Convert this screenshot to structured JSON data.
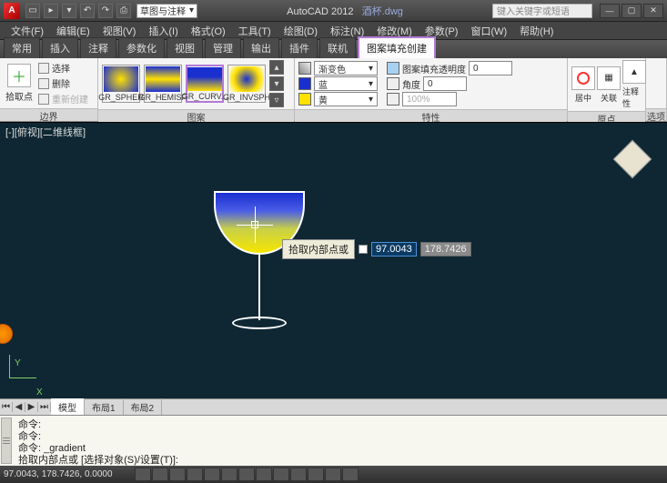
{
  "titlebar": {
    "app_letter": "A",
    "workspace_selector": "草图与注释",
    "app_name": "AutoCAD 2012",
    "doc_name": "酒杯.dwg",
    "search_placeholder": "键入关键字或短语"
  },
  "menubar": [
    "文件(F)",
    "编辑(E)",
    "视图(V)",
    "插入(I)",
    "格式(O)",
    "工具(T)",
    "绘图(D)",
    "标注(N)",
    "修改(M)",
    "参数(P)",
    "窗口(W)",
    "帮助(H)"
  ],
  "tabs": {
    "items": [
      "常用",
      "插入",
      "注释",
      "参数化",
      "视图",
      "管理",
      "输出",
      "插件",
      "联机",
      "图案填充创建"
    ],
    "active_index": 9
  },
  "ribbon": {
    "panel1": {
      "title": "边界",
      "big_label": "拾取点",
      "opt1": "选择",
      "opt2": "删除",
      "opt3": "重新创建"
    },
    "panel2": {
      "title": "图案",
      "items": [
        "GR_SPHER",
        "GR_HEMISP",
        "GR_CURV...",
        "GR_INVSPH"
      ],
      "selected_index": 2
    },
    "panel3": {
      "title": "特性",
      "pattern_label": "渐变色",
      "color1_label": "蓝",
      "color2_label": "黄",
      "transparency_label": "图案填充透明度",
      "transparency_value": "0",
      "angle_label": "角度",
      "angle_value": "0",
      "scale_value": "100%"
    },
    "panel4": {
      "title": "原点",
      "btn1": "居中",
      "btn2": "关联",
      "btn3": "注释性"
    },
    "panel5": {
      "title": "选项"
    }
  },
  "canvas": {
    "view_label": "[-][俯视][二维线框]",
    "tooltip": "拾取内部点或",
    "coord_x": "97.0043",
    "coord_y": "178.7426",
    "ucs_y": "Y",
    "ucs_x": "X"
  },
  "layout_tabs": {
    "items": [
      "模型",
      "布局1",
      "布局2"
    ],
    "active_index": 0
  },
  "command": {
    "lines": [
      "命令:",
      "命令:",
      "命令: _gradient",
      "拾取内部点或 [选择对象(S)/设置(T)]:"
    ]
  },
  "statusbar": {
    "coords": "97.0043, 178.7426, 0.0000"
  }
}
